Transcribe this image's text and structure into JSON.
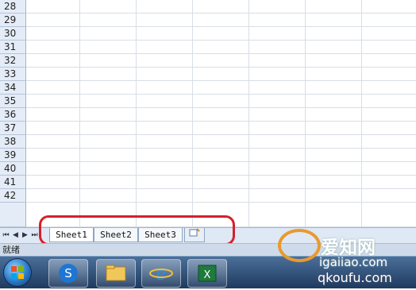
{
  "rows": [
    "28",
    "29",
    "30",
    "31",
    "32",
    "33",
    "34",
    "35",
    "36",
    "37",
    "38",
    "39",
    "40",
    "41",
    "42"
  ],
  "sheet_tabs": [
    {
      "label": "Sheet1",
      "active": true
    },
    {
      "label": "Sheet2",
      "active": false
    },
    {
      "label": "Sheet3",
      "active": false
    }
  ],
  "status": {
    "ready": "就绪"
  },
  "taskbar": {
    "items": [
      {
        "icon": "windows-start-icon"
      },
      {
        "icon": "sogou-icon"
      },
      {
        "icon": "file-explorer-icon"
      },
      {
        "icon": "internet-explorer-icon"
      },
      {
        "icon": "excel-icon"
      }
    ]
  },
  "watermark": {
    "line1": "爱知网",
    "line2": "igaiiao.com",
    "line3": "qkoufu.com"
  },
  "colors": {
    "highlight": "#d4202b",
    "tabbar": "#dfe8f5",
    "taskbar": "#1f3a5f",
    "excel_green": "#1f7a3d"
  }
}
